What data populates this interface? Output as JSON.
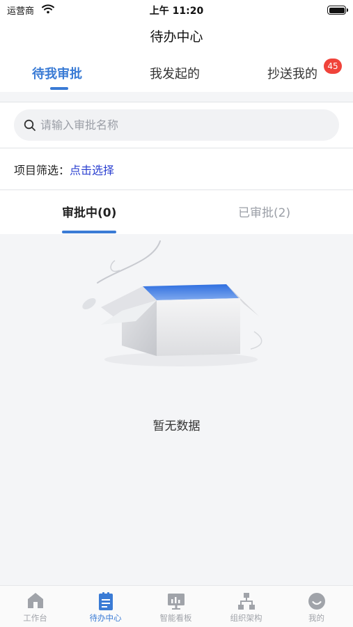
{
  "status_bar": {
    "carrier": "运营商",
    "time": "上午 11:20"
  },
  "nav": {
    "title": "待办中心"
  },
  "top_tabs": [
    {
      "label": "待我审批",
      "active": true
    },
    {
      "label": "我发起的",
      "active": false
    },
    {
      "label": "抄送我的",
      "active": false,
      "badge": "45"
    }
  ],
  "search": {
    "placeholder": "请输入审批名称",
    "value": ""
  },
  "filter": {
    "label": "项目筛选：",
    "action": "点击选择"
  },
  "sub_tabs": [
    {
      "label": "审批中(0)",
      "active": true
    },
    {
      "label": "已审批(2)",
      "active": false
    }
  ],
  "empty_state": {
    "text": "暂无数据",
    "icon": "empty-box-illustration"
  },
  "tab_bar": [
    {
      "label": "工作台",
      "icon": "home-icon",
      "active": false
    },
    {
      "label": "待办中心",
      "icon": "clipboard-icon",
      "active": true
    },
    {
      "label": "智能看板",
      "icon": "dashboard-icon",
      "active": false
    },
    {
      "label": "组织架构",
      "icon": "org-chart-icon",
      "active": false
    },
    {
      "label": "我的",
      "icon": "smile-icon",
      "active": false
    }
  ],
  "colors": {
    "accent": "#3a7bd5",
    "badge": "#f0433a",
    "link": "#2a3fd0",
    "inactive": "#a0a3a9"
  }
}
